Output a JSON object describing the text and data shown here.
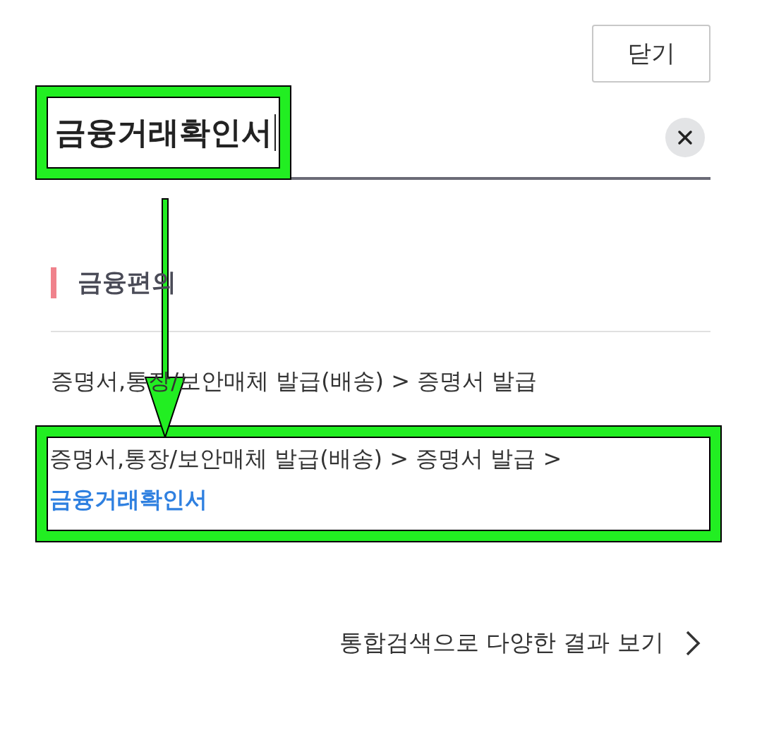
{
  "close_button": "닫기",
  "search": {
    "value": "금융거래확인서",
    "highlighted": true
  },
  "section": {
    "title": "금융편의",
    "results": [
      {
        "path": "증명서,통장/보안매체 발급(배송) > 증명서 발급",
        "highlighted": false
      },
      {
        "path": "증명서,통장/보안매체 발급(배송) > 증명서 발급 > ",
        "match": "금융거래확인서",
        "highlighted": true
      }
    ]
  },
  "more_link": "통합검색으로 다양한 결과 보기",
  "annotations": [
    {
      "kind": "arrow"
    }
  ]
}
